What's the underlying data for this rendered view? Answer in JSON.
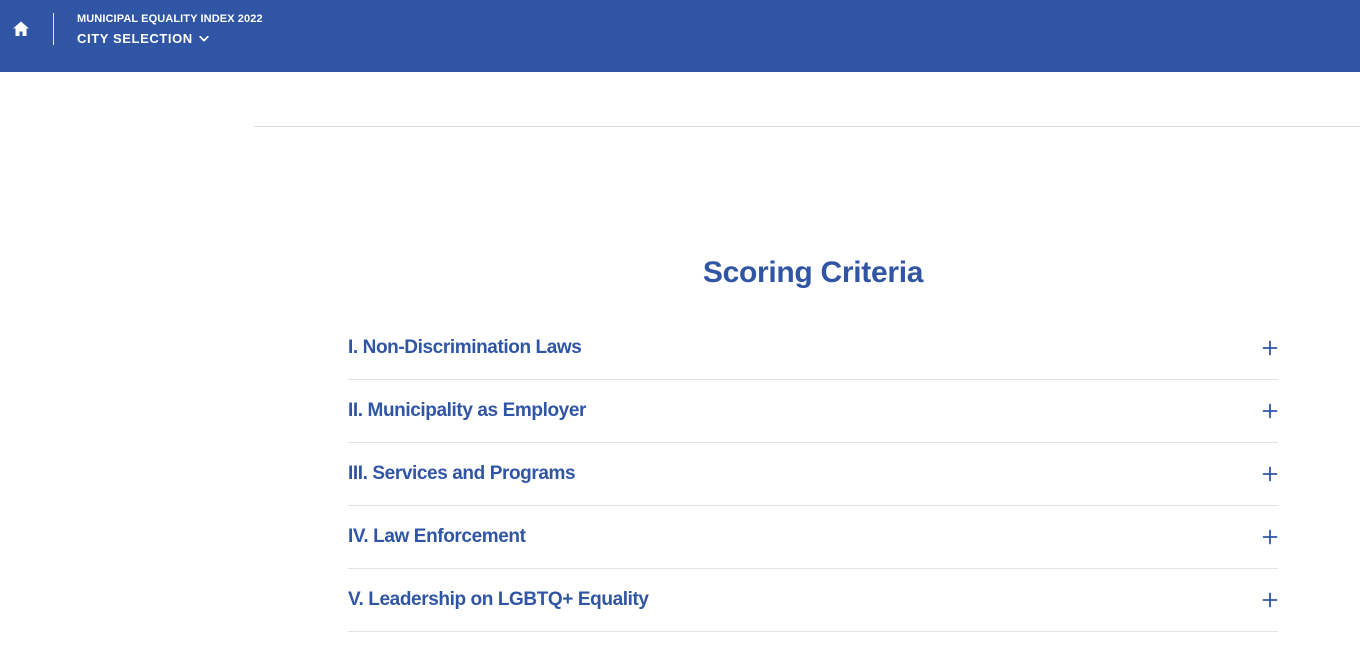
{
  "header": {
    "index_title": "MUNICIPAL EQUALITY INDEX 2022",
    "city_selection_label": "CITY SELECTION",
    "home_icon": "home-icon",
    "dropdown_icon": "chevron-down-icon"
  },
  "main": {
    "title": "Scoring Criteria",
    "criteria": [
      {
        "label": "I. Non-Discrimination Laws",
        "icon": "plus-icon"
      },
      {
        "label": "II. Municipality as Employer",
        "icon": "plus-icon"
      },
      {
        "label": "III. Services and Programs",
        "icon": "plus-icon"
      },
      {
        "label": "IV. Law Enforcement",
        "icon": "plus-icon"
      },
      {
        "label": "V. Leadership on LGBTQ+ Equality",
        "icon": "plus-icon"
      }
    ]
  },
  "colors": {
    "brand_blue": "#2f55a4",
    "divider": "#e0e3ea",
    "background": "#ffffff"
  }
}
